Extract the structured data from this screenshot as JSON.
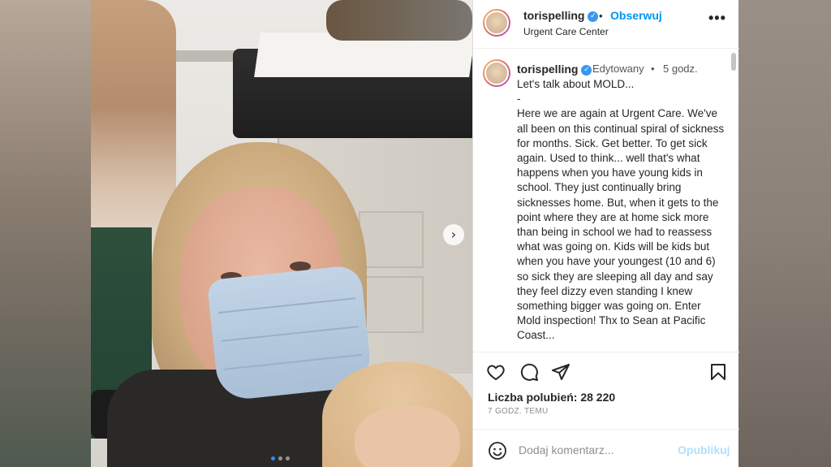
{
  "header": {
    "username": "torispelling",
    "follow_separator": "•",
    "follow_label": "Obserwuj",
    "location": "Urgent Care Center",
    "more_label": "•••"
  },
  "caption": {
    "username": "torispelling",
    "edited_label": "Edytowany",
    "separator": "•",
    "time": "5 godz.",
    "text": "Let's talk about MOLD...\n-\nHere we are again at Urgent Care. We've all been on this continual spiral of sickness for months. Sick. Get better. To get sick again. Used to think... well that's what happens when you have young kids in school. They just continually bring sicknesses home. But, when it gets to the point where they are at home sick more than being in school we had to reassess what was going on. Kids will be kids but when you have your youngest (10 and 6) so sick they are sleeping all day and say they feel dizzy even standing I knew something bigger was going on. Enter Mold inspection! Thx to Sean at Pacific Coast..."
  },
  "actions": {
    "like_icon": "heart-icon",
    "comment_icon": "comment-icon",
    "share_icon": "share-icon",
    "save_icon": "bookmark-icon"
  },
  "stats": {
    "likes": "Liczba polubień: 28 220",
    "posted_ago": "7 GODZ. TEMU"
  },
  "comment": {
    "placeholder": "Dodaj komentarz...",
    "publish_label": "Opublikuj"
  },
  "carousel": {
    "next_label": "›",
    "slide_count": 3,
    "active_index": 0
  },
  "colors": {
    "accent": "#0095f6",
    "verified": "#3897f0",
    "publish_disabled": "#b2dffc"
  }
}
